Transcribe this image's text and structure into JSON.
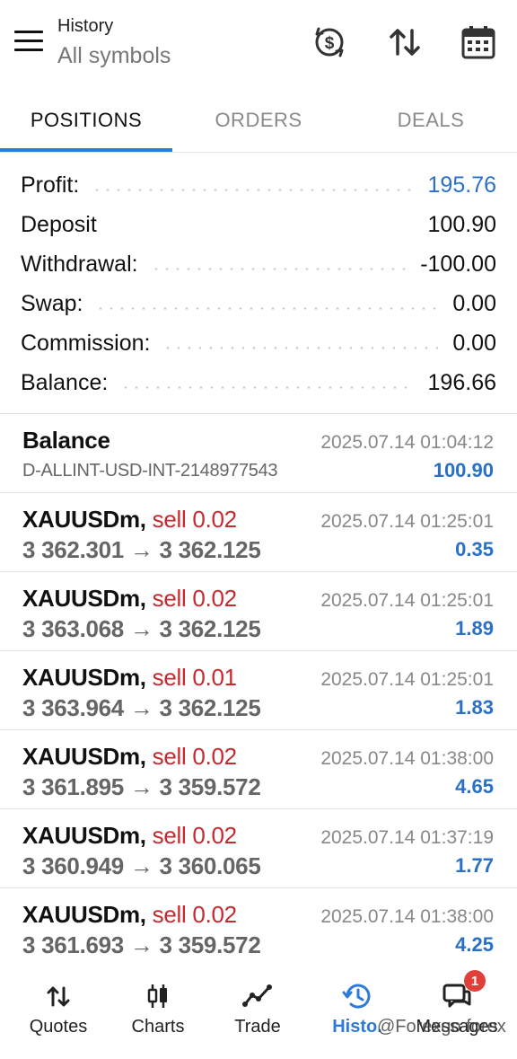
{
  "header": {
    "title_small": "History",
    "title_large": "All symbols"
  },
  "tabs": [
    {
      "label": "POSITIONS",
      "active": true
    },
    {
      "label": "ORDERS",
      "active": false
    },
    {
      "label": "DEALS",
      "active": false
    }
  ],
  "summary": [
    {
      "label": "Profit:",
      "value": "195.76",
      "highlight": true
    },
    {
      "label": "Deposit",
      "value": "100.90",
      "highlight": false
    },
    {
      "label": "Withdrawal:",
      "value": "-100.00",
      "highlight": false
    },
    {
      "label": "Swap:",
      "value": "0.00",
      "highlight": false
    },
    {
      "label": "Commission:",
      "value": "0.00",
      "highlight": false
    },
    {
      "label": "Balance:",
      "value": "196.66",
      "highlight": false
    }
  ],
  "balance_entry": {
    "title": "Balance",
    "account": "D-ALLINT-USD-INT-2148977543",
    "time": "2025.07.14 01:04:12",
    "amount": "100.90"
  },
  "positions": [
    {
      "symbol": "XAUUSDm,",
      "side": "sell 0.02",
      "prices": "3 362.301 → 3 362.125",
      "time": "2025.07.14 01:25:01",
      "profit": "0.35"
    },
    {
      "symbol": "XAUUSDm,",
      "side": "sell 0.02",
      "prices": "3 363.068 → 3 362.125",
      "time": "2025.07.14 01:25:01",
      "profit": "1.89"
    },
    {
      "symbol": "XAUUSDm,",
      "side": "sell 0.01",
      "prices": "3 363.964 → 3 362.125",
      "time": "2025.07.14 01:25:01",
      "profit": "1.83"
    },
    {
      "symbol": "XAUUSDm,",
      "side": "sell 0.02",
      "prices": "3 361.895 → 3 359.572",
      "time": "2025.07.14 01:38:00",
      "profit": "4.65"
    },
    {
      "symbol": "XAUUSDm,",
      "side": "sell 0.02",
      "prices": "3 360.949 → 3 360.065",
      "time": "2025.07.14 01:37:19",
      "profit": "1.77"
    },
    {
      "symbol": "XAUUSDm,",
      "side": "sell 0.02",
      "prices": "3 361.693 → 3 359.572",
      "time": "2025.07.14 01:38:00",
      "profit": "4.25"
    }
  ],
  "nav": [
    {
      "label": "Quotes",
      "icon": "quotes-icon",
      "active": false
    },
    {
      "label": "Charts",
      "icon": "charts-icon",
      "active": false
    },
    {
      "label": "Trade",
      "icon": "trade-icon",
      "active": false
    },
    {
      "label": "Histo.",
      "icon": "history-icon",
      "active": true
    },
    {
      "label": "Messages",
      "icon": "messages-icon",
      "active": false,
      "badge": "1"
    }
  ],
  "watermark": "@Forexgo forex",
  "colors": {
    "accent": "#2e7ad6",
    "profit_blue": "#2a70c6",
    "sell_red": "#c8282e",
    "badge_red": "#e0403a"
  }
}
